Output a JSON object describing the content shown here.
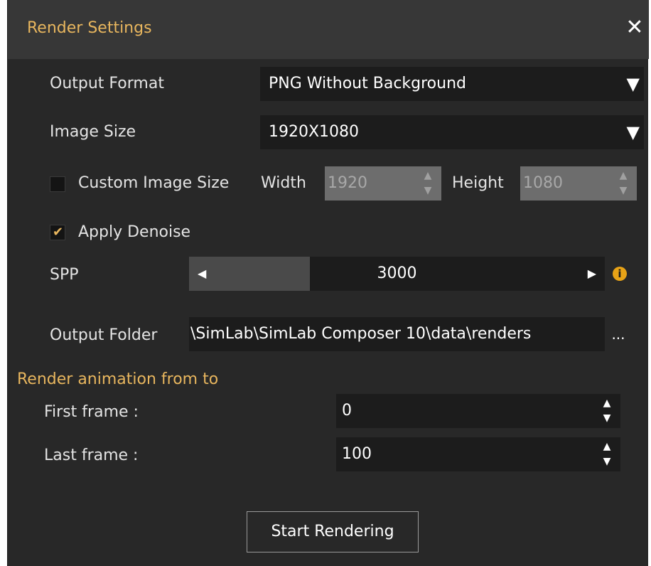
{
  "window": {
    "title": "Render Settings",
    "close_icon": "close-icon"
  },
  "output_format": {
    "label": "Output Format",
    "value": "PNG Without Background"
  },
  "image_size": {
    "label": "Image Size",
    "value": "1920X1080"
  },
  "custom_size": {
    "checkbox_label": "Custom Image Size",
    "checked": false,
    "width_label": "Width",
    "width_value": "1920",
    "height_label": "Height",
    "height_value": "1080"
  },
  "denoise": {
    "label": "Apply Denoise",
    "checked": true
  },
  "spp": {
    "label": "SPP",
    "value": "3000",
    "fill_fraction": 0.29
  },
  "output_folder": {
    "label": "Output Folder",
    "value": "\\SimLab\\SimLab Composer 10\\data\\renders",
    "browse_label": "..."
  },
  "animation": {
    "section_title": "Render animation from to",
    "first_label": "First frame :",
    "first_value": "0",
    "last_label": "Last frame :",
    "last_value": "100"
  },
  "actions": {
    "start_label": "Start Rendering"
  },
  "colors": {
    "accent": "#e8b65e",
    "background": "#282828",
    "titlebar": "#373737",
    "field": "#1c1c1c",
    "disabled_field": "#6d6d6d",
    "info": "#e8a317"
  }
}
